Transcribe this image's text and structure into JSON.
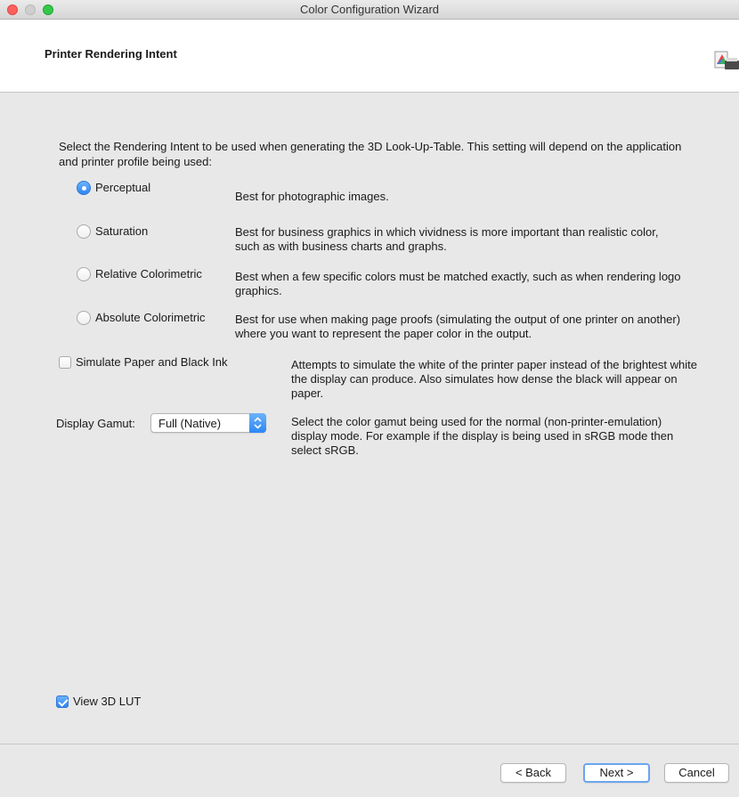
{
  "window": {
    "title": "Color Configuration Wizard"
  },
  "header": {
    "title": "Printer Rendering Intent",
    "logo_icon": "color-wizard-logo-icon"
  },
  "intro": "Select the Rendering Intent to be used when generating the 3D Look-Up-Table. This setting will depend on the application and printer profile being used:",
  "intents": [
    {
      "label": "Perceptual",
      "selected": true,
      "description": "Best for photographic images."
    },
    {
      "label": "Saturation",
      "selected": false,
      "description": "Best for business graphics in which vividness is more important than realistic color, such as with business charts and graphs."
    },
    {
      "label": "Relative Colorimetric",
      "selected": false,
      "description": "Best when a few specific colors must be matched exactly, such as when rendering logo graphics."
    },
    {
      "label": "Absolute Colorimetric",
      "selected": false,
      "description": "Best for use when making page proofs (simulating the output of one printer on another) where you want to represent the paper color in the output."
    }
  ],
  "simulate": {
    "label": "Simulate Paper and Black Ink",
    "checked": false,
    "description": "Attempts to simulate the white of the printer paper instead of the brightest white the display can produce. Also simulates how dense the black will appear on paper."
  },
  "gamut": {
    "label": "Display Gamut:",
    "value": "Full (Native)",
    "description": "Select the color gamut being used for the normal (non-printer-emulation) display mode. For example if the display is being used in sRGB mode then select sRGB."
  },
  "view_lut": {
    "label": "View 3D LUT",
    "checked": true
  },
  "buttons": {
    "back": "< Back",
    "next": "Next >",
    "cancel": "Cancel"
  },
  "colors": {
    "accent": "#2d86f3",
    "header_bg": "#ffffff",
    "window_bg": "#e8e8e8",
    "close": "#fc605c",
    "zoom": "#34c84a"
  }
}
